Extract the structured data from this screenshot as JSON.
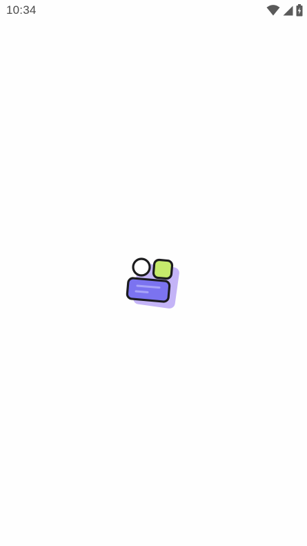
{
  "status_bar": {
    "time": "10:34",
    "icons": [
      "wifi-icon",
      "cellular-signal-icon",
      "battery-charging-icon"
    ]
  },
  "splash": {
    "logo": "app-logo"
  },
  "colors": {
    "background": "#fefefe",
    "status_text": "#4a4a4a",
    "logo_outline": "#1c1c1e",
    "logo_purple": "#7b73f0",
    "logo_lavender": "#c4b4f7",
    "logo_lime": "#c6ea6c"
  }
}
